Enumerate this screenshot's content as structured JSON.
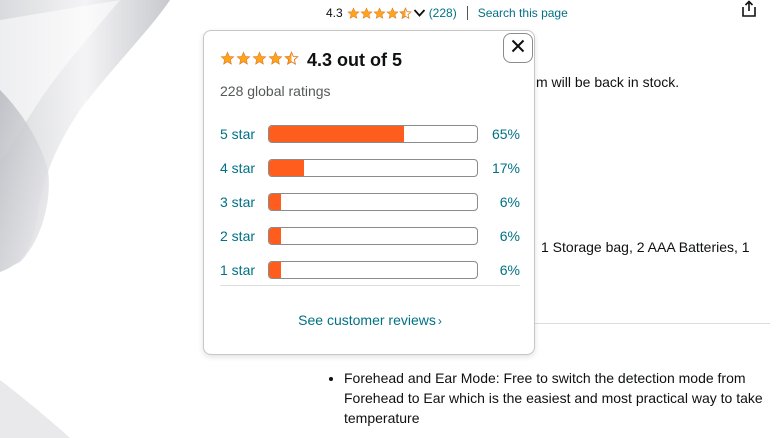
{
  "top_bar": {
    "rating_value": "4.3",
    "rating_count": "(228)",
    "search_link": "Search this page",
    "share_icon": "share-icon"
  },
  "popover": {
    "title": "4.3 out of 5",
    "global_ratings": "228 global ratings",
    "close_icon": "close-icon",
    "histogram": [
      {
        "label": "5 star",
        "percent": "65%",
        "value": 65
      },
      {
        "label": "4 star",
        "percent": "17%",
        "value": 17
      },
      {
        "label": "3 star",
        "percent": "6%",
        "value": 6
      },
      {
        "label": "2 star",
        "percent": "6%",
        "value": 6
      },
      {
        "label": "1 star",
        "percent": "6%",
        "value": 6
      }
    ],
    "see_reviews": "See customer reviews",
    "see_reviews_arrow": "›"
  },
  "details": {
    "stock_fragment": "m will be back in stock.",
    "included_fragment": "1 Storage bag, 2 AAA Batteries, 1",
    "bullets": [
      "Forehead and Ear Mode: Free to switch the detection mode from Forehead to Ear which is the easiest and most practical way to take temperature"
    ]
  },
  "colors": {
    "accent_orange": "#fe5d1d",
    "star_orange": "#ffa41c",
    "link_teal": "#007185"
  }
}
